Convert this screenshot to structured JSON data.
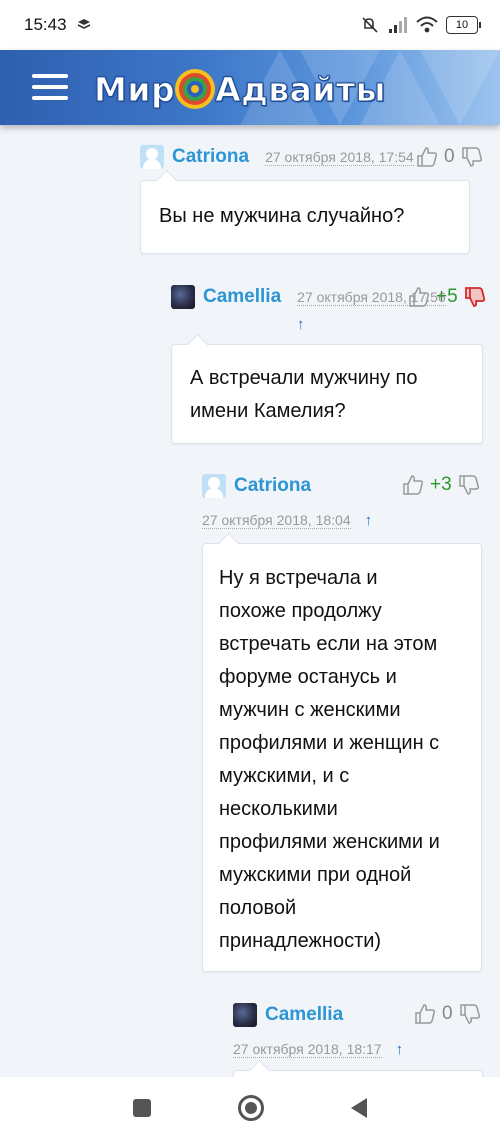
{
  "status_bar": {
    "time": "15:43",
    "battery": "10"
  },
  "header": {
    "logo_left": "Мир",
    "logo_right": "Адвайты"
  },
  "comments": [
    {
      "author": "Catriona",
      "date": "27 октября 2018, 17:54",
      "score": "0",
      "text": "Вы не мужчина случайно?"
    },
    {
      "author": "Camellia",
      "date": "27 октября 2018, 17:56",
      "arrow": "↑",
      "score": "+5",
      "text_lines": [
        "А встречали мужчину по",
        "имени Камелия?"
      ]
    },
    {
      "author": "Catriona",
      "date": "27 октября 2018, 18:04",
      "arrow": "↑",
      "score": "+3",
      "text_lines": [
        "Ну я встречала и",
        "похоже продолжу",
        "встречать если на этом",
        "форуме останусь и",
        "мужчин с женскими",
        "профилями и женщин с",
        "мужскими, и с",
        "несколькими",
        "профилями женскими и",
        "мужскими при одной",
        "половой",
        "принадлежности)"
      ]
    },
    {
      "author": "Camellia",
      "date": "27 октября 2018, 18:17",
      "arrow": "↑",
      "score": "0"
    }
  ],
  "colors": {
    "author": "#2c95d3",
    "score_plus": "#2c9a2c",
    "dislike_active": "#d62a2a"
  }
}
